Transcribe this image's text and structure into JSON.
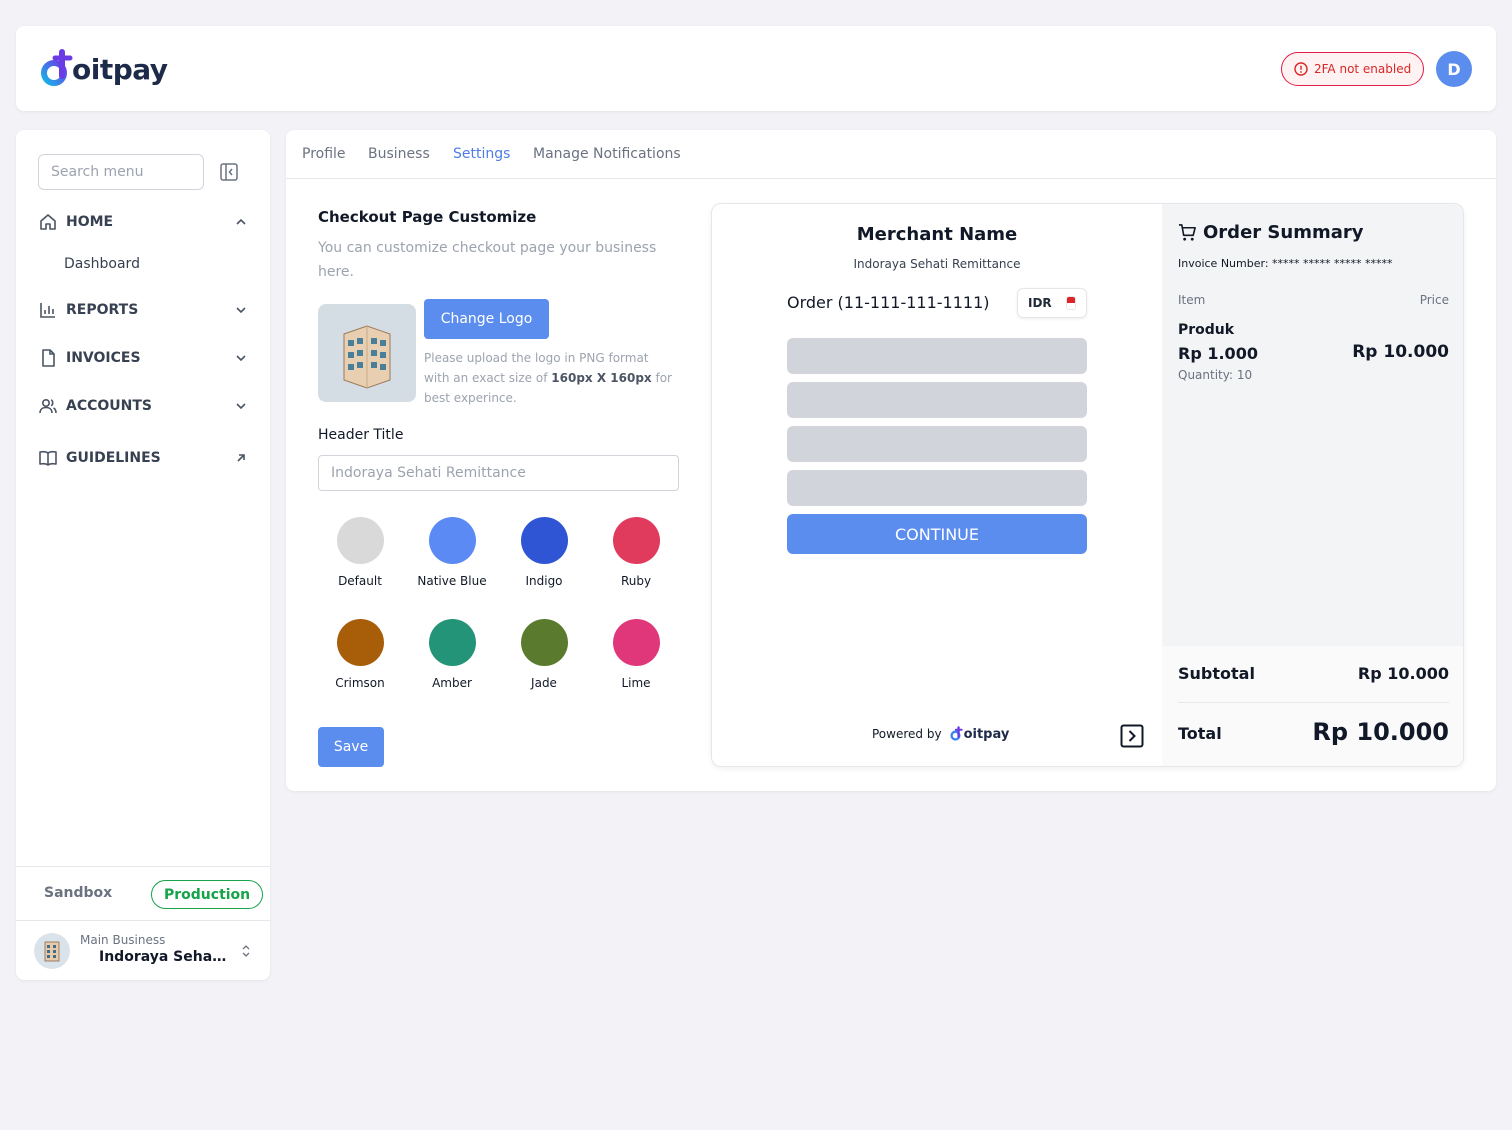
{
  "header": {
    "logo_text": "oitpay",
    "twofa_label": "2FA not enabled",
    "avatar_initial": "D",
    "colors": {
      "brand_blue": "#5b8def",
      "alert_red": "#dc2626"
    }
  },
  "sidebar": {
    "search_placeholder": "Search menu",
    "items": [
      {
        "label": "HOME",
        "icon": "home-icon",
        "state": "expanded"
      },
      {
        "label": "REPORTS",
        "icon": "bar-chart-icon",
        "state": "collapsed"
      },
      {
        "label": "INVOICES",
        "icon": "document-icon",
        "state": "collapsed"
      },
      {
        "label": "ACCOUNTS",
        "icon": "users-icon",
        "state": "collapsed"
      },
      {
        "label": "GUIDELINES",
        "icon": "book-icon",
        "state": "external"
      }
    ],
    "home_sub": "Dashboard",
    "env": {
      "sandbox": "Sandbox",
      "production": "Production",
      "active": "Production"
    },
    "business": {
      "label": "Main Business",
      "name": "Indoraya Sehati Remittance"
    }
  },
  "tabs": [
    {
      "label": "Profile"
    },
    {
      "label": "Business"
    },
    {
      "label": "Settings",
      "active": true
    },
    {
      "label": "Manage Notifications"
    }
  ],
  "customize": {
    "title": "Checkout Page Customize",
    "description": "You can customize checkout page your business here.",
    "change_logo": "Change Logo",
    "note_prefix": "Please upload the logo in PNG format with an exact size of",
    "note_size": "160px X 160px",
    "note_suffix": "for best experince.",
    "header_title_label": "Header Title",
    "header_title_placeholder": "Indoraya Sehati Remittance",
    "colors": [
      {
        "name": "Default",
        "hex": "#d9d9d9"
      },
      {
        "name": "Native Blue",
        "hex": "#5b8af5"
      },
      {
        "name": "Indigo",
        "hex": "#2f55d4"
      },
      {
        "name": "Ruby",
        "hex": "#e03a5c"
      },
      {
        "name": "Crimson",
        "hex": "#a85d08"
      },
      {
        "name": "Amber",
        "hex": "#239477"
      },
      {
        "name": "Jade",
        "hex": "#5a7a2d"
      },
      {
        "name": "Lime",
        "hex": "#e0377a"
      }
    ],
    "save": "Save"
  },
  "preview": {
    "merchant_name": "Merchant Name",
    "merchant_sub": "Indoraya Sehati Remittance",
    "order": "Order (11-111-111-1111)",
    "currency": "IDR",
    "continue": "CONTINUE",
    "powered_by": "Powered by",
    "powered_logo": "oitpay"
  },
  "summary": {
    "title": "Order Summary",
    "invoice": "Invoice Number: ***** ***** ***** *****",
    "col_item": "Item",
    "col_price": "Price",
    "product": "Produk",
    "unit_price": "Rp 1.000",
    "line_total": "Rp 10.000",
    "quantity": "Quantity: 10",
    "subtotal_label": "Subtotal",
    "subtotal_value": "Rp 10.000",
    "total_label": "Total",
    "total_value": "Rp 10.000"
  }
}
